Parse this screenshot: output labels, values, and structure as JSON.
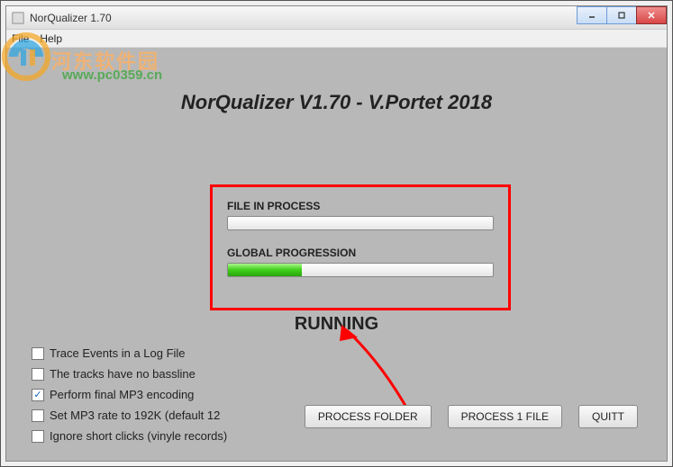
{
  "window": {
    "title": "NorQualizer 1.70"
  },
  "menu": {
    "file": "File",
    "help": "Help"
  },
  "watermark": {
    "text1": "河东软件园",
    "text2": "www.pc0359.cn"
  },
  "heading": "NorQualizer V1.70 - V.Portet 2018",
  "progress": {
    "file_label": "FILE IN PROCESS",
    "file_value": 0,
    "global_label": "GLOBAL PROGRESSION",
    "global_value": 28
  },
  "status": "RUNNING",
  "checkboxes": [
    {
      "label": "Trace Events in a Log File",
      "checked": false
    },
    {
      "label": "The tracks have no bassline",
      "checked": false
    },
    {
      "label": "Perform final MP3 encoding",
      "checked": true
    },
    {
      "label": "Set MP3 rate to 192K (default 12",
      "checked": false
    },
    {
      "label": "Ignore short clicks (vinyle records)",
      "checked": false
    }
  ],
  "buttons": {
    "process_folder": "PROCESS FOLDER",
    "process_file": "PROCESS 1 FILE",
    "quit": "QUITT"
  }
}
